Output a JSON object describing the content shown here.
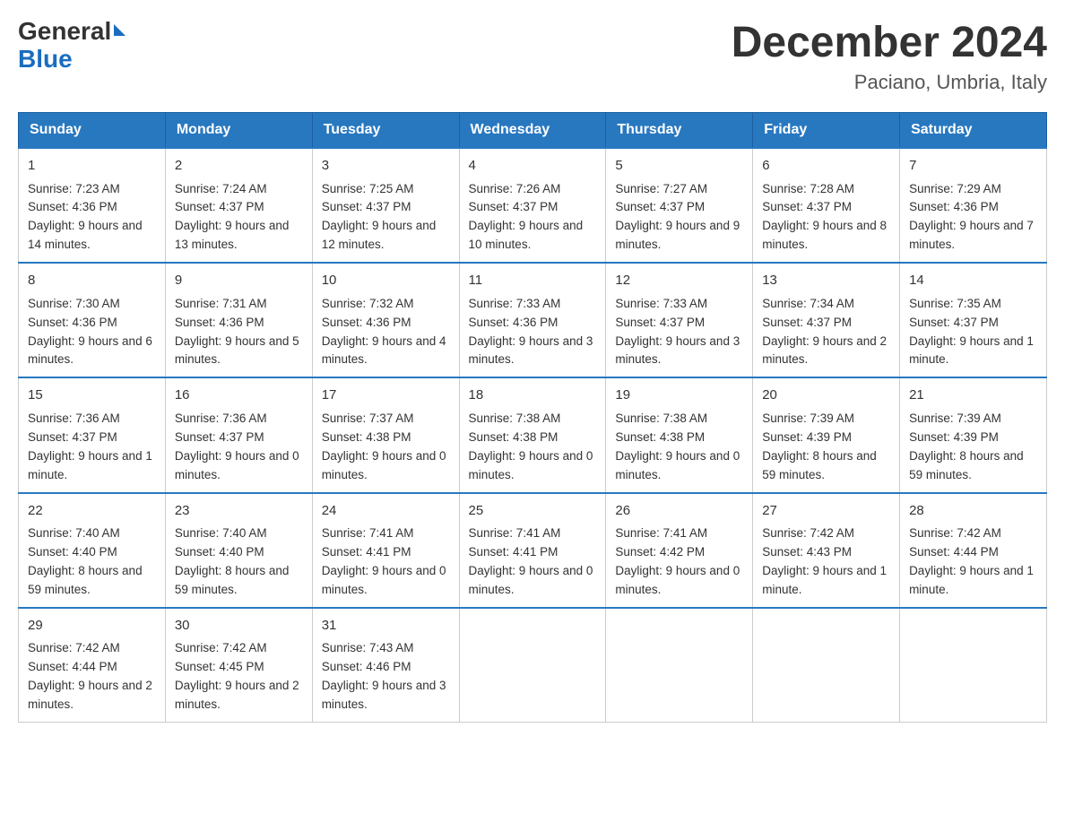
{
  "header": {
    "logo_general": "General",
    "logo_blue": "Blue",
    "title": "December 2024",
    "subtitle": "Paciano, Umbria, Italy"
  },
  "weekdays": [
    "Sunday",
    "Monday",
    "Tuesday",
    "Wednesday",
    "Thursday",
    "Friday",
    "Saturday"
  ],
  "weeks": [
    [
      {
        "day": "1",
        "sunrise": "7:23 AM",
        "sunset": "4:36 PM",
        "daylight": "9 hours and 14 minutes."
      },
      {
        "day": "2",
        "sunrise": "7:24 AM",
        "sunset": "4:37 PM",
        "daylight": "9 hours and 13 minutes."
      },
      {
        "day": "3",
        "sunrise": "7:25 AM",
        "sunset": "4:37 PM",
        "daylight": "9 hours and 12 minutes."
      },
      {
        "day": "4",
        "sunrise": "7:26 AM",
        "sunset": "4:37 PM",
        "daylight": "9 hours and 10 minutes."
      },
      {
        "day": "5",
        "sunrise": "7:27 AM",
        "sunset": "4:37 PM",
        "daylight": "9 hours and 9 minutes."
      },
      {
        "day": "6",
        "sunrise": "7:28 AM",
        "sunset": "4:37 PM",
        "daylight": "9 hours and 8 minutes."
      },
      {
        "day": "7",
        "sunrise": "7:29 AM",
        "sunset": "4:36 PM",
        "daylight": "9 hours and 7 minutes."
      }
    ],
    [
      {
        "day": "8",
        "sunrise": "7:30 AM",
        "sunset": "4:36 PM",
        "daylight": "9 hours and 6 minutes."
      },
      {
        "day": "9",
        "sunrise": "7:31 AM",
        "sunset": "4:36 PM",
        "daylight": "9 hours and 5 minutes."
      },
      {
        "day": "10",
        "sunrise": "7:32 AM",
        "sunset": "4:36 PM",
        "daylight": "9 hours and 4 minutes."
      },
      {
        "day": "11",
        "sunrise": "7:33 AM",
        "sunset": "4:36 PM",
        "daylight": "9 hours and 3 minutes."
      },
      {
        "day": "12",
        "sunrise": "7:33 AM",
        "sunset": "4:37 PM",
        "daylight": "9 hours and 3 minutes."
      },
      {
        "day": "13",
        "sunrise": "7:34 AM",
        "sunset": "4:37 PM",
        "daylight": "9 hours and 2 minutes."
      },
      {
        "day": "14",
        "sunrise": "7:35 AM",
        "sunset": "4:37 PM",
        "daylight": "9 hours and 1 minute."
      }
    ],
    [
      {
        "day": "15",
        "sunrise": "7:36 AM",
        "sunset": "4:37 PM",
        "daylight": "9 hours and 1 minute."
      },
      {
        "day": "16",
        "sunrise": "7:36 AM",
        "sunset": "4:37 PM",
        "daylight": "9 hours and 0 minutes."
      },
      {
        "day": "17",
        "sunrise": "7:37 AM",
        "sunset": "4:38 PM",
        "daylight": "9 hours and 0 minutes."
      },
      {
        "day": "18",
        "sunrise": "7:38 AM",
        "sunset": "4:38 PM",
        "daylight": "9 hours and 0 minutes."
      },
      {
        "day": "19",
        "sunrise": "7:38 AM",
        "sunset": "4:38 PM",
        "daylight": "9 hours and 0 minutes."
      },
      {
        "day": "20",
        "sunrise": "7:39 AM",
        "sunset": "4:39 PM",
        "daylight": "8 hours and 59 minutes."
      },
      {
        "day": "21",
        "sunrise": "7:39 AM",
        "sunset": "4:39 PM",
        "daylight": "8 hours and 59 minutes."
      }
    ],
    [
      {
        "day": "22",
        "sunrise": "7:40 AM",
        "sunset": "4:40 PM",
        "daylight": "8 hours and 59 minutes."
      },
      {
        "day": "23",
        "sunrise": "7:40 AM",
        "sunset": "4:40 PM",
        "daylight": "8 hours and 59 minutes."
      },
      {
        "day": "24",
        "sunrise": "7:41 AM",
        "sunset": "4:41 PM",
        "daylight": "9 hours and 0 minutes."
      },
      {
        "day": "25",
        "sunrise": "7:41 AM",
        "sunset": "4:41 PM",
        "daylight": "9 hours and 0 minutes."
      },
      {
        "day": "26",
        "sunrise": "7:41 AM",
        "sunset": "4:42 PM",
        "daylight": "9 hours and 0 minutes."
      },
      {
        "day": "27",
        "sunrise": "7:42 AM",
        "sunset": "4:43 PM",
        "daylight": "9 hours and 1 minute."
      },
      {
        "day": "28",
        "sunrise": "7:42 AM",
        "sunset": "4:44 PM",
        "daylight": "9 hours and 1 minute."
      }
    ],
    [
      {
        "day": "29",
        "sunrise": "7:42 AM",
        "sunset": "4:44 PM",
        "daylight": "9 hours and 2 minutes."
      },
      {
        "day": "30",
        "sunrise": "7:42 AM",
        "sunset": "4:45 PM",
        "daylight": "9 hours and 2 minutes."
      },
      {
        "day": "31",
        "sunrise": "7:43 AM",
        "sunset": "4:46 PM",
        "daylight": "9 hours and 3 minutes."
      },
      null,
      null,
      null,
      null
    ]
  ]
}
